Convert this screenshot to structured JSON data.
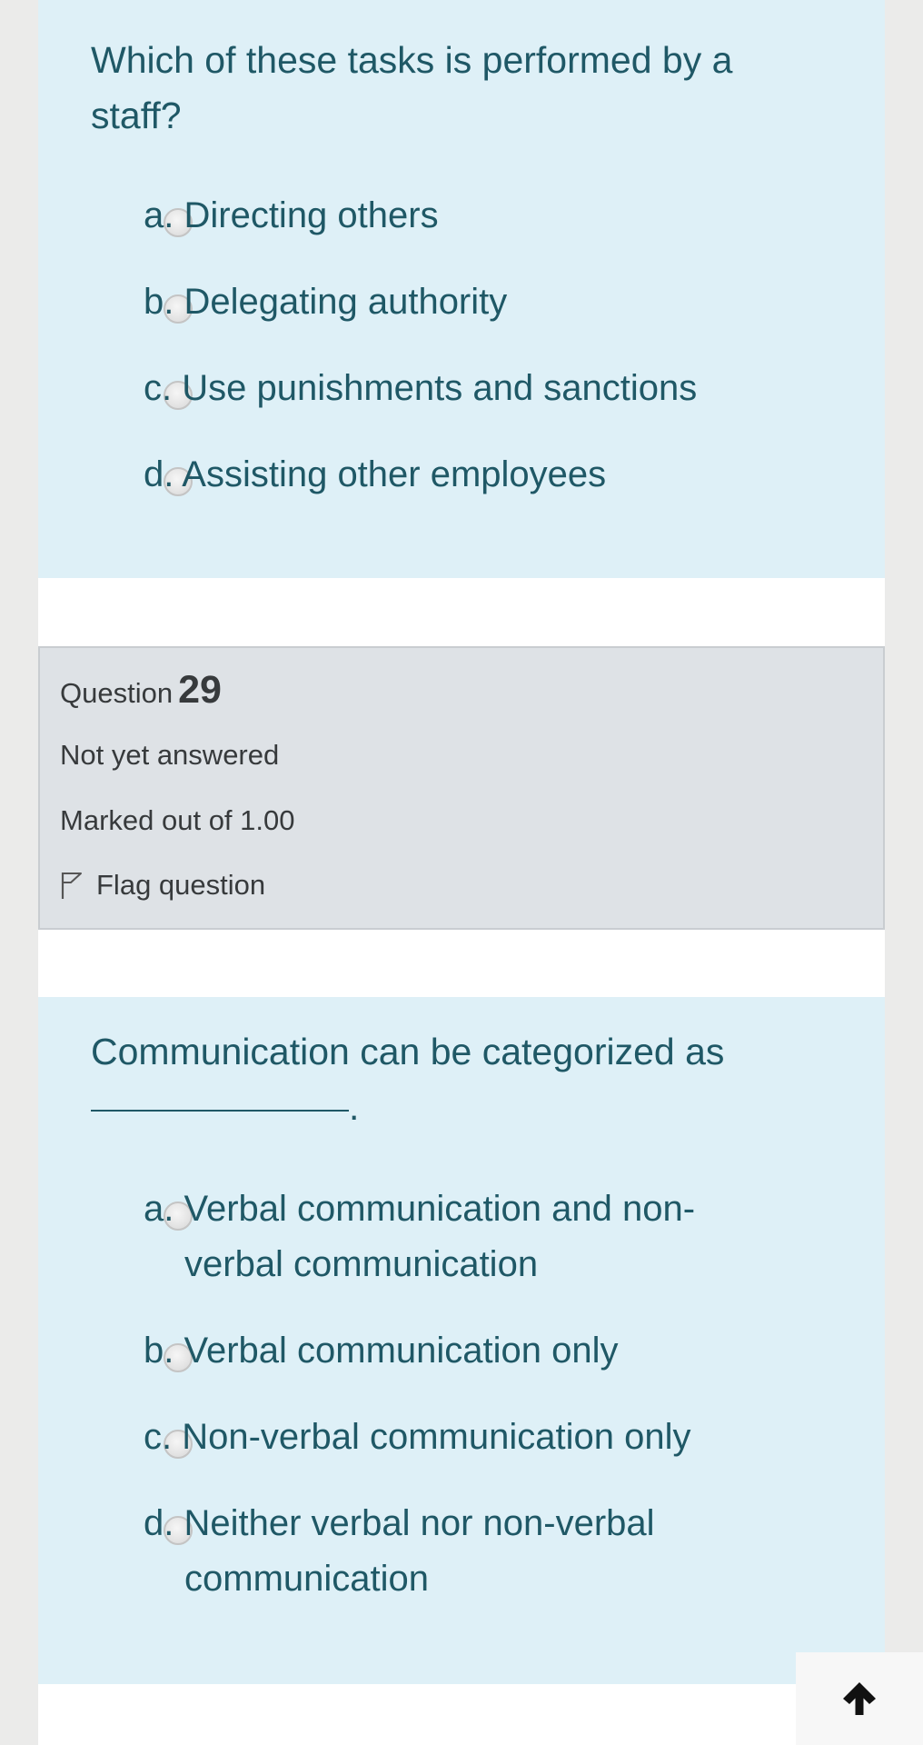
{
  "question28": {
    "text": "Which of these tasks is performed by a staff?",
    "answers": [
      {
        "label": "a. Directing others"
      },
      {
        "label": "b. Delegating authority"
      },
      {
        "label": "c. Use punishments and sanctions"
      },
      {
        "label": "d. Assisting other employees"
      }
    ]
  },
  "question29": {
    "info": {
      "question_label": "Question",
      "number": "29",
      "state": "Not yet answered",
      "grade": "Marked out of 1.00",
      "flag_label": "Flag question"
    },
    "text_line1": "Communication can be categorized as",
    "text_end": ".",
    "answers": [
      {
        "label_line1": "a. Verbal communication and non-",
        "label_line2": "verbal communication"
      },
      {
        "label": "b. Verbal communication only"
      },
      {
        "label": "c. Non-verbal communication only"
      },
      {
        "label_line1": "d. Neither verbal nor non-verbal",
        "label_line2": "communication"
      }
    ]
  },
  "icons": {
    "flag": "flag-outline-icon",
    "scroll_top": "arrow-up-icon"
  },
  "colors": {
    "question_bg": "#def0f7",
    "question_text": "#1f5866",
    "info_bg": "#dee2e6",
    "info_text": "#373a3c"
  }
}
